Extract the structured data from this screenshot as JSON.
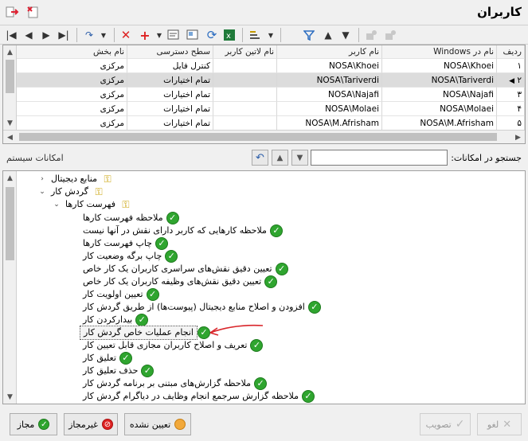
{
  "window": {
    "title": "کاربران"
  },
  "grid": {
    "columns": [
      "ردیف",
      "نام در Windows",
      "نام کاربر",
      "نام لاتین کاربر",
      "سطح دسترسی",
      "نام بخش"
    ],
    "rows": [
      {
        "idx": "۱",
        "win": "NOSA\\Khoei",
        "user": "NOSA\\Khoei",
        "latin": "",
        "access": "کنترل فایل",
        "dept": "مرکزی"
      },
      {
        "idx": "۲",
        "win": "NOSA\\Tariverdi",
        "user": "NOSA\\Tariverdi",
        "latin": "",
        "access": "تمام اختیارات",
        "dept": "مرکزی"
      },
      {
        "idx": "۳",
        "win": "NOSA\\Najafi",
        "user": "NOSA\\Najafi",
        "latin": "",
        "access": "تمام اختیارات",
        "dept": "مرکزی"
      },
      {
        "idx": "۴",
        "win": "NOSA\\Molaei",
        "user": "NOSA\\Molaei",
        "latin": "",
        "access": "تمام اختیارات",
        "dept": "مرکزی"
      },
      {
        "idx": "۵",
        "win": "NOSA\\M.Afrisham",
        "user": "NOSA\\M.Afrisham",
        "latin": "",
        "access": "تمام اختیارات",
        "dept": "مرکزی"
      }
    ]
  },
  "search": {
    "label": "جستجو در امکانات:",
    "value": "",
    "section_title": "امکانات سیستم"
  },
  "tree": {
    "nodes": [
      {
        "label": "منابع دیجیتال",
        "level": 0,
        "kind": "key",
        "expander": "›"
      },
      {
        "label": "گردش کار",
        "level": 0,
        "kind": "key",
        "expander": "⌄"
      },
      {
        "label": "فهرست کارها",
        "level": 1,
        "kind": "key",
        "expander": "⌄"
      },
      {
        "label": "ملاحظه فهرست کارها",
        "level": 2,
        "kind": "check"
      },
      {
        "label": "ملاحظه کارهایی که کاربر دارای نقش در آنها نیست",
        "level": 2,
        "kind": "check"
      },
      {
        "label": "چاپ فهرست کارها",
        "level": 2,
        "kind": "check"
      },
      {
        "label": "چاپ برگه وضعیت کار",
        "level": 2,
        "kind": "check"
      },
      {
        "label": "تعیین دقیق نقش‌های سراسری کاربران یک کار خاص",
        "level": 2,
        "kind": "check"
      },
      {
        "label": "تعیین دقیق نقش‌های وظیفه کاربران یک کار خاص",
        "level": 2,
        "kind": "check"
      },
      {
        "label": "تعیین اولویت کار",
        "level": 2,
        "kind": "check"
      },
      {
        "label": "افزودن و اصلاح منابع دیجیتال (پیوست‌ها) از طریق گردش کار",
        "level": 2,
        "kind": "check"
      },
      {
        "label": "بیدارکردن کار",
        "level": 2,
        "kind": "check"
      },
      {
        "label": "انجام عملیات خاص گردش کار",
        "level": 2,
        "kind": "check",
        "highlight": true
      },
      {
        "label": "تعریف و اصلاح کاربران مجازی قابل تعیین کار",
        "level": 2,
        "kind": "check"
      },
      {
        "label": "تعلیق کار",
        "level": 2,
        "kind": "check"
      },
      {
        "label": "حذف تعلیق کار",
        "level": 2,
        "kind": "check"
      },
      {
        "label": "ملاحظه گزارش‌های مبتنی بر برنامه گردش کار",
        "level": 2,
        "kind": "check"
      },
      {
        "label": "ملاحظه گزارش سرجمع انجام وظایف در دیاگرام گردش کار",
        "level": 2,
        "kind": "check"
      }
    ]
  },
  "buttons": {
    "allowed": "مجاز",
    "denied": "غیرمجاز",
    "unset": "تعیین نشده",
    "approve": "تصویب",
    "cancel": "لغو"
  },
  "colors": {
    "selected_row": "#dcdcdc",
    "check_green": "#2fa52f",
    "annotation_arrow": "#d9262b"
  }
}
